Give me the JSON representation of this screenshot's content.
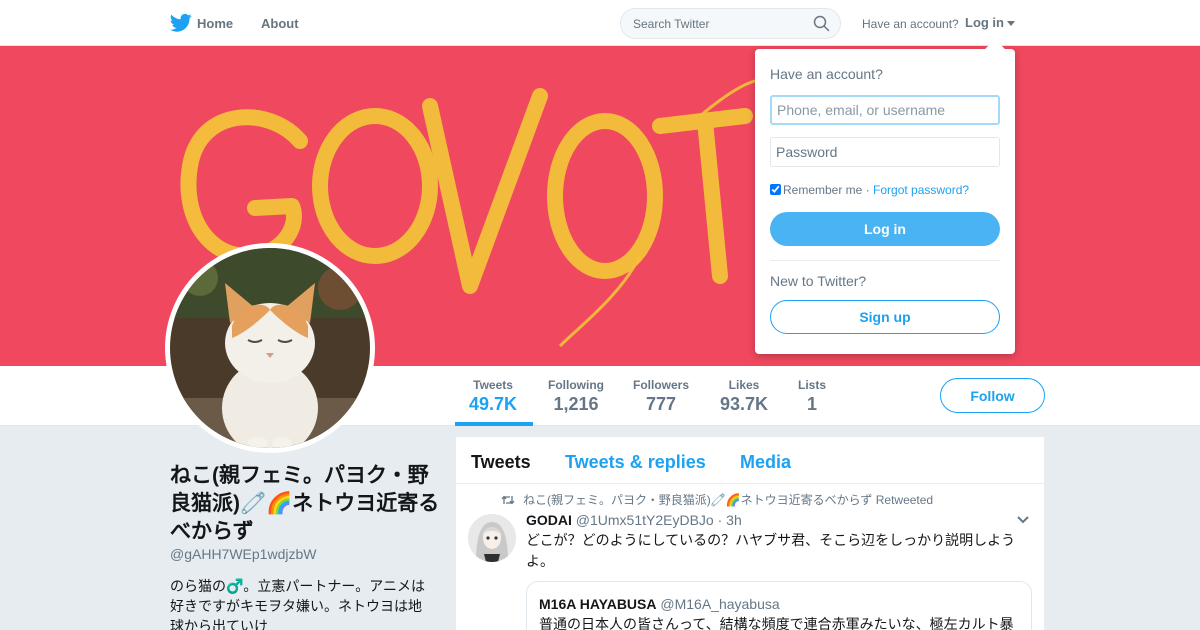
{
  "nav": {
    "home_label": "Home",
    "about_label": "About",
    "search_placeholder": "Search Twitter",
    "have_account": "Have an account?",
    "login_label": "Log in"
  },
  "banner": {
    "color": "#f0485e",
    "text": "GO VOTE"
  },
  "stats": {
    "tweets": {
      "label": "Tweets",
      "value": "49.7K"
    },
    "following": {
      "label": "Following",
      "value": "1,216"
    },
    "followers": {
      "label": "Followers",
      "value": "777"
    },
    "likes": {
      "label": "Likes",
      "value": "93.7K"
    },
    "lists": {
      "label": "Lists",
      "value": "1"
    }
  },
  "follow_label": "Follow",
  "profile": {
    "name": "ねこ(親フェミ。パヨク・野良猫派)🧷🌈ネトウヨ近寄るべからず",
    "handle": "@gAHH7WEp1wdjzbW",
    "bio": "のら猫の♂️。立憲パートナー。アニメは好きですがキモヲタ嫌い。ネトウヨは地球から出ていけ"
  },
  "timeline": {
    "tabs": [
      "Tweets",
      "Tweets & replies",
      "Media"
    ],
    "retweet_context": "ねこ(親フェミ。パヨク・野良猫派)🧷🌈ネトウヨ近寄るべからず Retweeted",
    "tweet": {
      "author": "GODAI",
      "handle": "@1Umx51tY2EyDBJo",
      "time": "· 3h",
      "text": "どこが？どのようにしているの？ハヤブサ君、そこら辺をしっかり説明しようよ。",
      "quote": {
        "author": "M16A HAYABUSA",
        "handle": "@M16A_hayabusa",
        "text": "普通の日本人の皆さんって、結構な頻度で連合赤軍みたいな、極左カルト暴"
      }
    }
  },
  "login_dropdown": {
    "title": "Have an account?",
    "username_placeholder": "Phone, email, or username",
    "password_placeholder": "Password",
    "remember_me": "Remember me",
    "separator": " · ",
    "forgot_password": "Forgot password?",
    "login_button": "Log in",
    "new_to_twitter": "New to Twitter?",
    "signup_button": "Sign up"
  },
  "colors": {
    "accent": "#1da1f2",
    "login_button": "#4ab3f4",
    "banner_bg": "#f0485e",
    "banner_text": "#f3c23a"
  }
}
